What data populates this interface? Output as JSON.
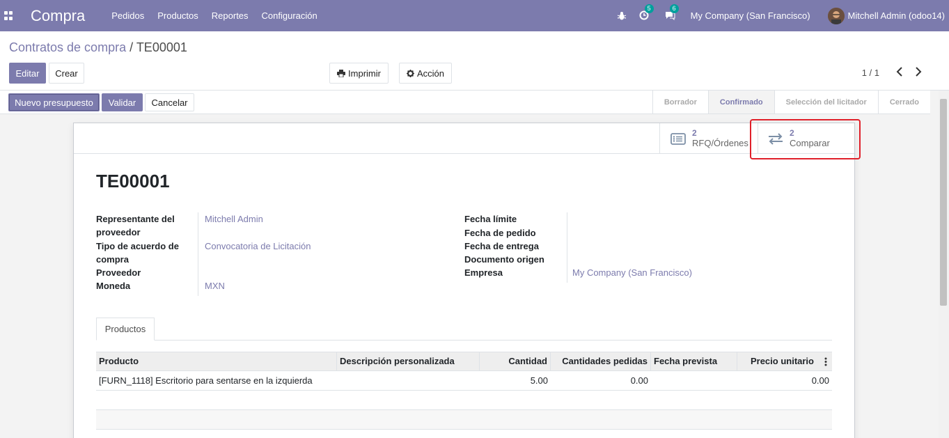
{
  "navbar": {
    "app_name": "Compra",
    "menu": [
      "Pedidos",
      "Productos",
      "Reportes",
      "Configuración"
    ],
    "activity_count": "5",
    "messages_count": "6",
    "company": "My Company (San Francisco)",
    "user": "Mitchell Admin (odoo14)"
  },
  "breadcrumb": {
    "parent": "Contratos de compra",
    "separator": "/",
    "current": "TE00001"
  },
  "toolbar": {
    "edit": "Editar",
    "create": "Crear",
    "print": "Imprimir",
    "action": "Acción",
    "pager": "1 / 1"
  },
  "statusbar": {
    "new_quote": "Nuevo presupuesto",
    "validate": "Validar",
    "cancel": "Cancelar",
    "stages": [
      "Borrador",
      "Confirmado",
      "Selección del licitador",
      "Cerrado"
    ],
    "active_stage": "Confirmado"
  },
  "smart_buttons": {
    "rfq": {
      "count": "2",
      "label": "RFQ/Órdenes"
    },
    "compare": {
      "count": "2",
      "label": "Comparar"
    }
  },
  "record": {
    "name": "TE00001",
    "left_fields": [
      {
        "label": "Representante del",
        "label2": "proveedor",
        "value": "Mitchell Admin"
      },
      {
        "label": "Tipo de acuerdo de",
        "label2": "compra",
        "value": "Convocatoria de Licitación"
      },
      {
        "label": "Proveedor",
        "value": ""
      },
      {
        "label": "Moneda",
        "value": "MXN"
      }
    ],
    "right_fields": [
      {
        "label": "Fecha límite",
        "value": ""
      },
      {
        "label": "Fecha de pedido",
        "value": ""
      },
      {
        "label": "Fecha de entrega",
        "value": ""
      },
      {
        "label": "Documento origen",
        "value": ""
      },
      {
        "label": "Empresa",
        "value": "My Company (San Francisco)"
      }
    ]
  },
  "tabs": {
    "products": "Productos"
  },
  "table": {
    "headers": [
      "Producto",
      "Descripción personalizada",
      "Cantidad",
      "Cantidades pedidas",
      "Fecha prevista",
      "Precio unitario"
    ],
    "rows": [
      {
        "product": "[FURN_1118] Escritorio para sentarse en la izquierda",
        "description": "",
        "qty": "5.00",
        "ordered": "0.00",
        "date": "",
        "price": "0.00"
      }
    ]
  }
}
